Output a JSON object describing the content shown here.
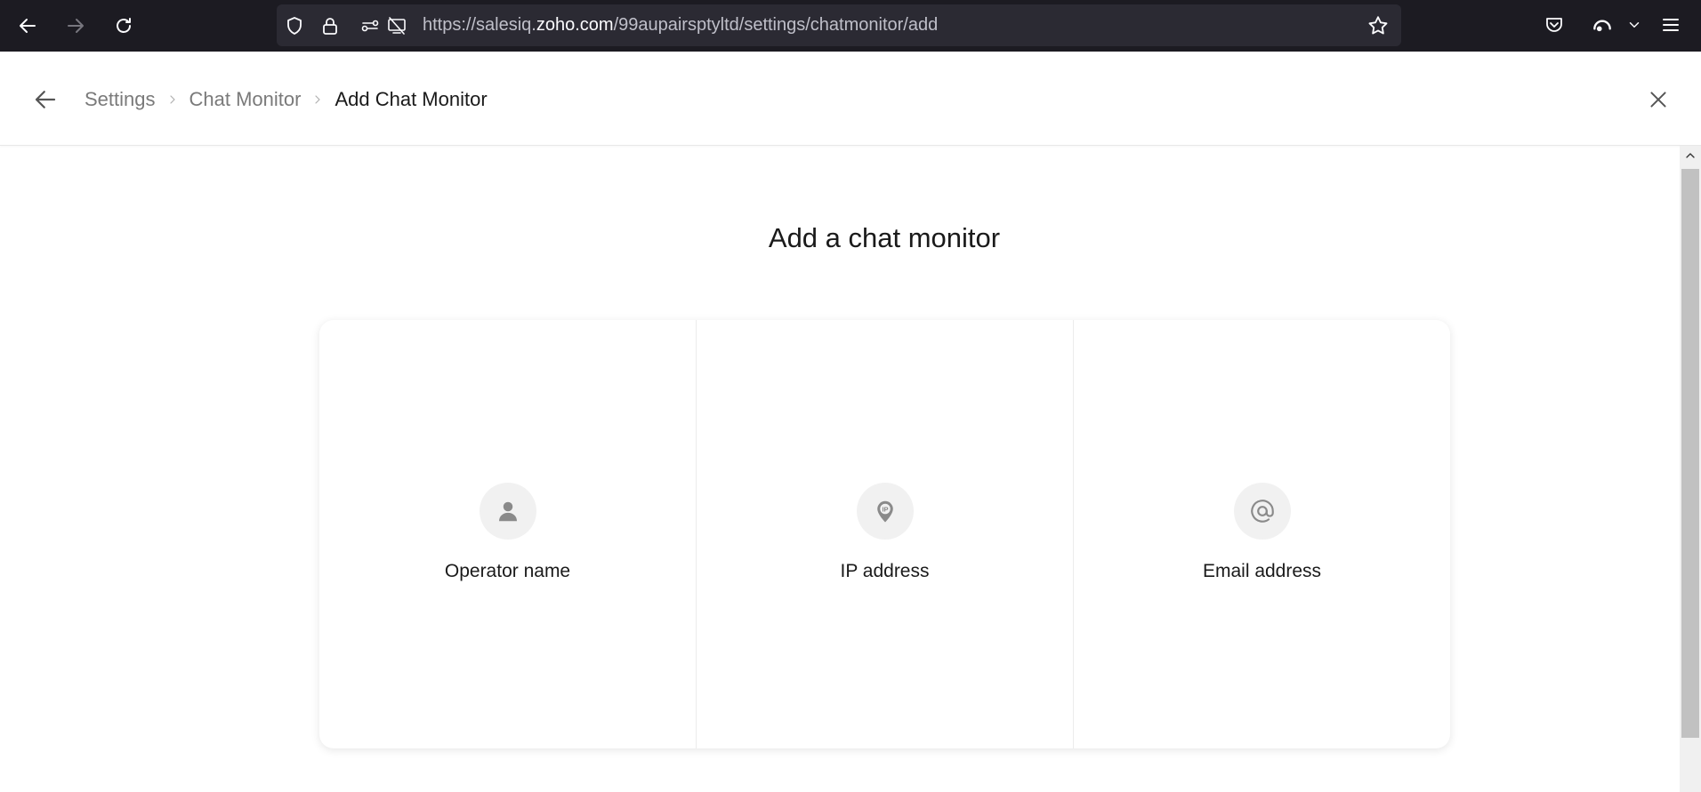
{
  "browser": {
    "url_prefix": "https://salesiq.",
    "url_domain": "zoho.com",
    "url_path": "/99aupairsptyltd/settings/chatmonitor/add"
  },
  "header": {
    "breadcrumb": [
      "Settings",
      "Chat Monitor",
      "Add Chat Monitor"
    ]
  },
  "main": {
    "title": "Add a chat monitor",
    "options": [
      {
        "label": "Operator name",
        "icon": "person-icon"
      },
      {
        "label": "IP address",
        "icon": "ip-pin-icon"
      },
      {
        "label": "Email address",
        "icon": "at-icon"
      }
    ]
  },
  "colors": {
    "chrome_bg": "#1c1b22",
    "urlbar_bg": "#2b2a33",
    "icon_gray": "#8a8a8a",
    "text_dark": "#1a1a1a"
  }
}
